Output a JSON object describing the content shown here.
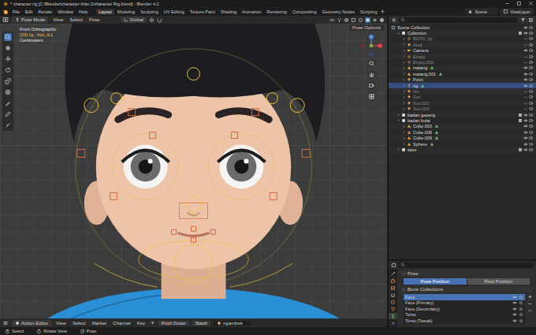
{
  "window": {
    "title": "* character rig [C:\\Blender\\character Irfan 2\\character Rig.blend] - Blender 4.2"
  },
  "menu": [
    "File",
    "Edit",
    "Render",
    "Window",
    "Help"
  ],
  "workspaces": [
    {
      "label": "Layout",
      "selected": true
    },
    {
      "label": "Modeling",
      "selected": false
    },
    {
      "label": "Sculpting",
      "selected": false
    },
    {
      "label": "UV Editing",
      "selected": false
    },
    {
      "label": "Texture Paint",
      "selected": false
    },
    {
      "label": "Shading",
      "selected": false
    },
    {
      "label": "Animation",
      "selected": false
    },
    {
      "label": "Rendering",
      "selected": false
    },
    {
      "label": "Compositing",
      "selected": false
    },
    {
      "label": "Geometry Nodes",
      "selected": false
    },
    {
      "label": "Scripting",
      "selected": false
    }
  ],
  "scene": "Scene",
  "view_layer": "ViewLayer",
  "viewport_header": {
    "mode": "Pose Mode",
    "menus": [
      "View",
      "Select",
      "Pose"
    ],
    "orientation": "Global",
    "options": "Pose Options"
  },
  "overlay": [
    {
      "text": "Front Orthographic",
      "highlight": false
    },
    {
      "text": "(33) rig : foot_ik.L",
      "highlight": true
    },
    {
      "text": "Centimeters",
      "highlight": false
    }
  ],
  "tools": [
    {
      "selected": true
    },
    {
      "selected": false
    },
    {
      "selected": false
    },
    {
      "selected": false
    },
    {
      "selected": false
    },
    {
      "selected": false
    },
    {
      "selected": false
    },
    {
      "selected": false
    },
    {
      "selected": false
    }
  ],
  "outliner": {
    "items": [
      {
        "label": "Scene Collection",
        "depth": 0,
        "kind": "scene",
        "expanded": true,
        "visible": true,
        "selected": false
      },
      {
        "label": "Collection",
        "depth": 1,
        "kind": "collection",
        "expanded": true,
        "visible": true,
        "selected": false
      },
      {
        "label": "BGTG_lig",
        "depth": 2,
        "kind": "empty",
        "expanded": false,
        "visible": false,
        "selected": false
      },
      {
        "label": "Area",
        "depth": 2,
        "kind": "light",
        "expanded": false,
        "visible": false,
        "selected": false
      },
      {
        "label": "Camera",
        "depth": 2,
        "kind": "camera",
        "expanded": false,
        "visible": true,
        "selected": false
      },
      {
        "label": "Empty",
        "depth": 2,
        "kind": "empty",
        "expanded": false,
        "visible": false,
        "selected": false
      },
      {
        "label": "Empty.003",
        "depth": 2,
        "kind": "empty",
        "expanded": false,
        "visible": false,
        "selected": false
      },
      {
        "label": "matang",
        "depth": 2,
        "kind": "mesh",
        "expanded": false,
        "visible": true,
        "selected": false
      },
      {
        "label": "matang.001",
        "depth": 2,
        "kind": "mesh",
        "expanded": false,
        "visible": true,
        "selected": false
      },
      {
        "label": "Point",
        "depth": 2,
        "kind": "light",
        "expanded": false,
        "visible": true,
        "selected": false
      },
      {
        "label": "rig",
        "depth": 2,
        "kind": "armature",
        "expanded": false,
        "visible": true,
        "selected": true
      },
      {
        "label": "rim",
        "depth": 2,
        "kind": "light",
        "expanded": false,
        "visible": false,
        "selected": false
      },
      {
        "label": "Sun",
        "depth": 2,
        "kind": "light",
        "expanded": false,
        "visible": false,
        "selected": false
      },
      {
        "label": "Sun.001",
        "depth": 2,
        "kind": "light",
        "expanded": false,
        "visible": false,
        "selected": false
      },
      {
        "label": "Sun.002",
        "depth": 2,
        "kind": "light",
        "expanded": false,
        "visible": false,
        "selected": false
      },
      {
        "label": "badan gepeng",
        "depth": 1,
        "kind": "collection",
        "expanded": false,
        "visible": true,
        "selected": false
      },
      {
        "label": "badan bulat",
        "depth": 1,
        "kind": "collection",
        "expanded": true,
        "visible": true,
        "selected": false
      },
      {
        "label": "Cube.003",
        "depth": 2,
        "kind": "mesh",
        "expanded": false,
        "visible": true,
        "selected": false
      },
      {
        "label": "Cube.008",
        "depth": 2,
        "kind": "mesh",
        "expanded": false,
        "visible": true,
        "selected": false
      },
      {
        "label": "Cube.009",
        "depth": 2,
        "kind": "mesh",
        "expanded": false,
        "visible": true,
        "selected": false
      },
      {
        "label": "Sphere",
        "depth": 2,
        "kind": "mesh",
        "expanded": false,
        "visible": true,
        "selected": false
      },
      {
        "label": "save",
        "depth": 1,
        "kind": "collection",
        "expanded": false,
        "visible": true,
        "selected": false
      }
    ]
  },
  "properties": {
    "tabs": [
      {
        "selected": false
      },
      {
        "selected": false
      },
      {
        "selected": false
      },
      {
        "selected": false
      },
      {
        "selected": false
      },
      {
        "selected": false
      },
      {
        "selected": true
      },
      {
        "selected": false
      }
    ],
    "section": "Pose",
    "pose_buttons": [
      {
        "label": "Pose Position",
        "selected": true
      },
      {
        "label": "Rest Position",
        "selected": false
      }
    ],
    "bone_collections_title": "Bone Collections",
    "bone_collections": [
      {
        "label": "Face",
        "selected": true
      },
      {
        "label": "Face (Primary)",
        "selected": false
      },
      {
        "label": "Face (Secondary)",
        "selected": false
      },
      {
        "label": "Torso",
        "selected": false
      },
      {
        "label": "Torso (Tweak)",
        "selected": false
      }
    ]
  },
  "timeline": {
    "editor": "Action Editor",
    "menus": [
      "View",
      "Select",
      "Marker",
      "Channel",
      "Key"
    ],
    "buttons": [
      "Push Down",
      "Stash"
    ],
    "action": "ngambek"
  },
  "status_bar": [
    "Select",
    "Rotate View",
    "Pose"
  ]
}
